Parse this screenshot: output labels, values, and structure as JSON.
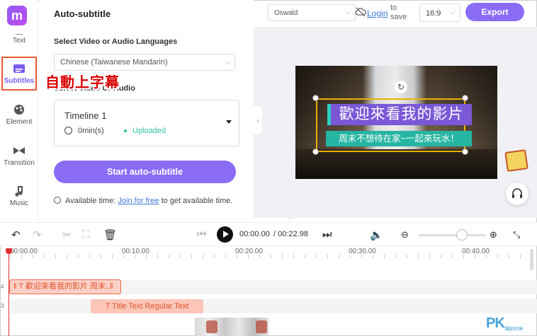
{
  "rail": {
    "logo": "m",
    "items": [
      {
        "label": "Text"
      },
      {
        "label": "Subtitles"
      },
      {
        "label": "Element"
      },
      {
        "label": "Transition"
      },
      {
        "label": "Music"
      }
    ]
  },
  "panel": {
    "title": "Auto-subtitle",
    "lang_label": "Select Video or Audio Languages",
    "lang_value": "Chinese (Taiwanese Mandarin)",
    "source_label": "Select Video Or Audio",
    "timeline_name": "Timeline 1",
    "duration": "0min(s)",
    "status": "Uploaded",
    "start_button": "Start auto-subtitle",
    "avail_prefix": "Available time:",
    "avail_link": "Join for free",
    "avail_suffix": "to get available time."
  },
  "overlay_text": "自動上字幕",
  "header": {
    "font": "Oswald",
    "login": "Login",
    "to_save": "to save",
    "ratio": "16:9",
    "export": "Export"
  },
  "canvas": {
    "title": "歡迎來看我的影片",
    "subtitle": "周末不想待在家~一起來玩水！"
  },
  "controls": {
    "current_time": "00:00.00",
    "total_time": "/ 00:22.98"
  },
  "ruler": [
    "00:00.00",
    "00:10.00",
    "00:20.00",
    "00:30.00",
    "00:40.00"
  ],
  "tracks": {
    "subtitle_clip": "‖ T 歡迎來看我的影片 周末..‖",
    "text_clip": "T Title Text Regular Text",
    "track_a": "4",
    "track_b": "3"
  },
  "watermark": {
    "main": "PK",
    "sub": "電腦王阿達"
  },
  "colors": {
    "accent": "#8b6cf5",
    "highlight": "#ee5a32",
    "teal": "#26b5a2",
    "link": "#3f78d8"
  }
}
